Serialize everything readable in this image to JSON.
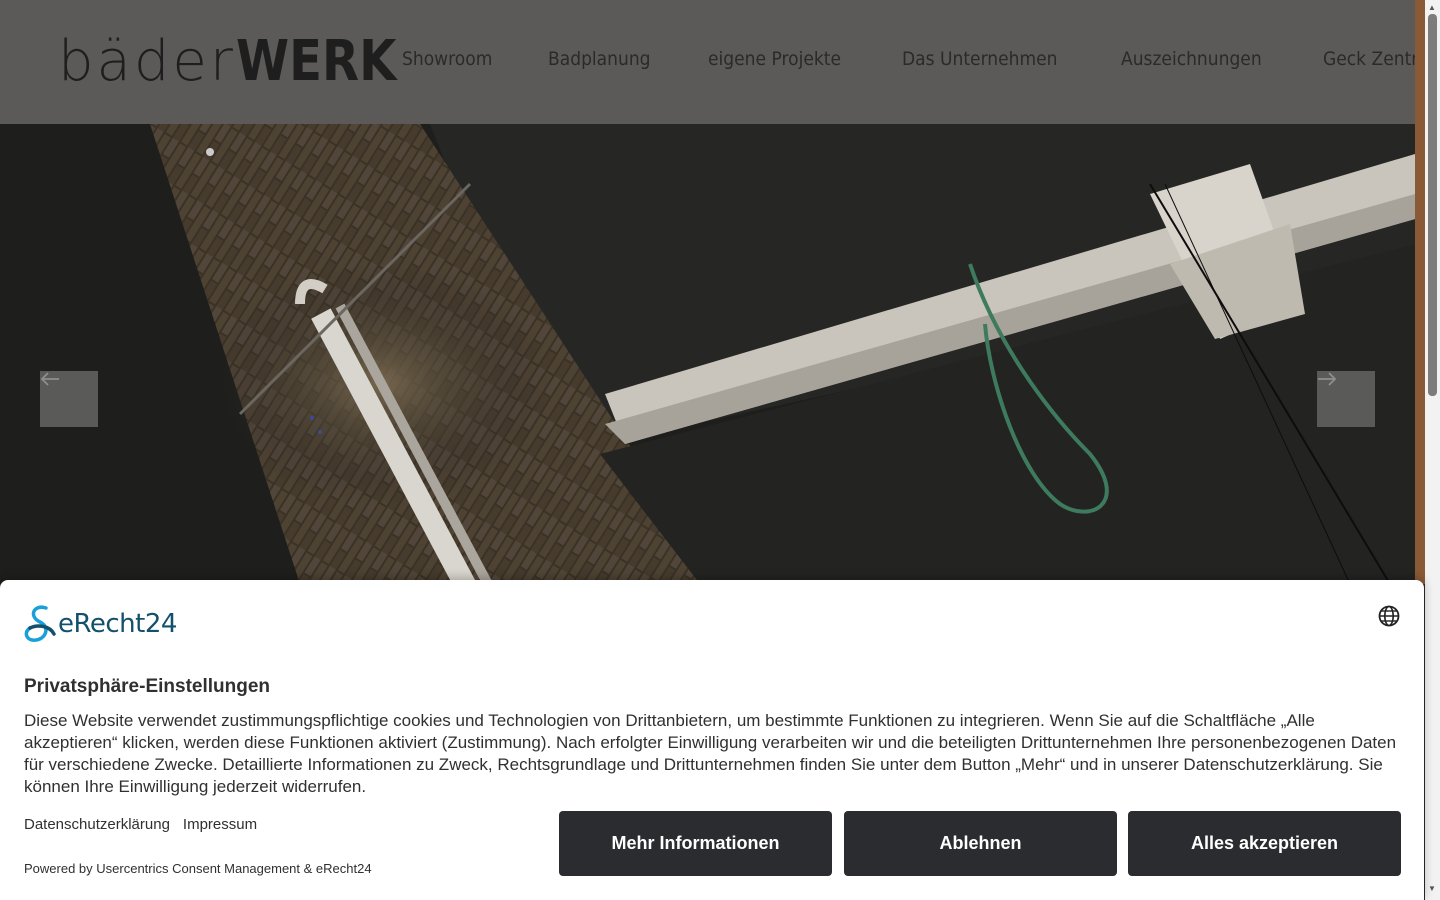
{
  "header": {
    "logo_light": "bäder",
    "logo_bold": "WERK",
    "nav": [
      "Showroom",
      "Badplanung",
      "eigene Projekte",
      "Das Unternehmen",
      "Auszeichnungen",
      "Geck Zentrum"
    ]
  },
  "slider": {
    "prev_icon": "arrow-left-icon",
    "next_icon": "arrow-right-icon"
  },
  "consent": {
    "brand": "eRecht24",
    "title": "Privatsphäre-Einstellungen",
    "text": "Diese Website verwendet zustimmungspflichtige cookies und Technologien von Drittanbietern, um bestimmte Funktionen zu integrieren. Wenn Sie auf die Schaltfläche „Alle akzeptieren“ klicken, werden diese Funktionen aktiviert (Zustimmung). Nach erfolgter Einwilligung verarbeiten wir und die beteiligten Drittunternehmen Ihre personenbezogenen Daten für verschiedene Zwecke. Detaillierte Informationen zu Zweck, Rechtsgrundlage und Drittunternehmen finden Sie unter dem Button „Mehr“ und in unserer Datenschutzerklärung. Sie können Ihre Einwilligung jederzeit widerrufen.",
    "link_privacy": "Datenschutzerklärung",
    "link_imprint": "Impressum",
    "powered": "Powered by Usercentrics Consent Management & eRecht24",
    "btn_more": "Mehr Informationen",
    "btn_deny": "Ablehnen",
    "btn_accept": "Alles akzeptieren"
  },
  "colors": {
    "header_bg": "#5b5a59",
    "button_bg": "#2b2c30",
    "brand_blue": "#14506b",
    "accent_stripe": "#8a5a36"
  }
}
